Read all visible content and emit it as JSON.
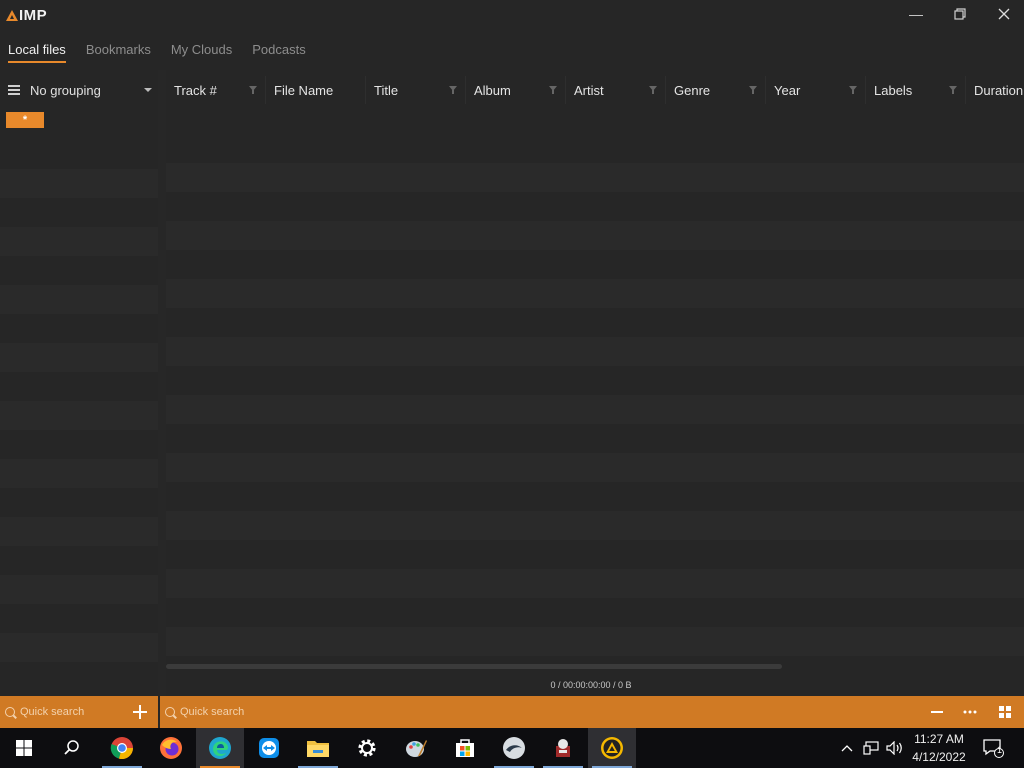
{
  "app": {
    "logo_text": "IMP",
    "accent": "#e8892b"
  },
  "window_controls": {
    "minimize": "—",
    "restore": "❐",
    "close": "✕"
  },
  "tabs": [
    {
      "label": "Local files",
      "active": true
    },
    {
      "label": "Bookmarks",
      "active": false
    },
    {
      "label": "My Clouds",
      "active": false
    },
    {
      "label": "Podcasts",
      "active": false
    }
  ],
  "sidebar": {
    "grouping_label": "No grouping",
    "all_badge": "*"
  },
  "columns": [
    "Track #",
    "File Name",
    "Title",
    "Album",
    "Artist",
    "Genre",
    "Year",
    "Labels",
    "Duration"
  ],
  "status": {
    "summary": "0 / 00:00:00:00 / 0 B"
  },
  "bottombar": {
    "left_search_placeholder": "Quick search",
    "right_search_placeholder": "Quick search"
  },
  "taskbar": {
    "apps": [
      "windows-start",
      "search",
      "chrome",
      "firefox",
      "edge",
      "teamviewer",
      "file-explorer",
      "settings",
      "paint",
      "store",
      "app-swirl",
      "app-game",
      "aimp"
    ],
    "clock_time": "11:27 AM",
    "clock_date": "4/12/2022",
    "notification_count": "1"
  }
}
